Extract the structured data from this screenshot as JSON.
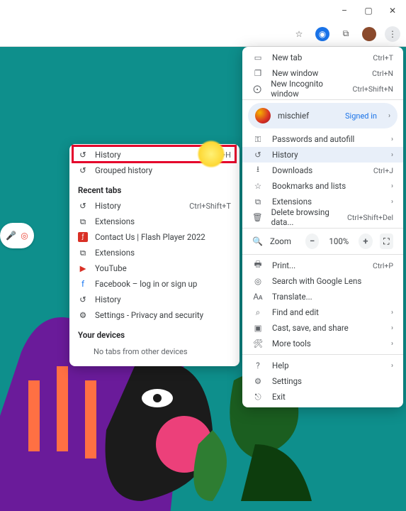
{
  "window_controls": {
    "min": "–",
    "max": "▢",
    "close": "✕"
  },
  "toolbar": {
    "star": "☆",
    "ext": "⧉",
    "more": "⋮"
  },
  "menu": {
    "new_tab": {
      "label": "New tab",
      "shortcut": "Ctrl+T"
    },
    "new_window": {
      "label": "New window",
      "shortcut": "Ctrl+N"
    },
    "incognito": {
      "label": "New Incognito window",
      "shortcut": "Ctrl+Shift+N"
    },
    "profile": {
      "name": "mischief",
      "state": "Signed in"
    },
    "passwords": {
      "label": "Passwords and autofill"
    },
    "history": {
      "label": "History"
    },
    "downloads": {
      "label": "Downloads",
      "shortcut": "Ctrl+J"
    },
    "bookmarks": {
      "label": "Bookmarks and lists"
    },
    "extensions": {
      "label": "Extensions"
    },
    "clear": {
      "label": "Delete browsing data...",
      "shortcut": "Ctrl+Shift+Del"
    },
    "zoom": {
      "label": "Zoom",
      "value": "100%"
    },
    "print": {
      "label": "Print...",
      "shortcut": "Ctrl+P"
    },
    "lens": {
      "label": "Search with Google Lens"
    },
    "translate": {
      "label": "Translate..."
    },
    "find": {
      "label": "Find and edit"
    },
    "cast": {
      "label": "Cast, save, and share"
    },
    "more_tools": {
      "label": "More tools"
    },
    "help": {
      "label": "Help"
    },
    "settings": {
      "label": "Settings"
    },
    "exit": {
      "label": "Exit"
    }
  },
  "submenu": {
    "history": {
      "label": "History",
      "shortcut": "Ctrl+H"
    },
    "grouped": {
      "label": "Grouped history"
    },
    "recent_title": "Recent tabs",
    "recents": [
      {
        "icon": "history",
        "label": "History",
        "shortcut": "Ctrl+Shift+T"
      },
      {
        "icon": "ext",
        "label": "Extensions",
        "shortcut": ""
      },
      {
        "icon": "flash",
        "label": "Contact Us | Flash Player 2022",
        "shortcut": ""
      },
      {
        "icon": "ext",
        "label": "Extensions",
        "shortcut": ""
      },
      {
        "icon": "yt",
        "label": "YouTube",
        "shortcut": ""
      },
      {
        "icon": "fb",
        "label": "Facebook – log in or sign up",
        "shortcut": ""
      },
      {
        "icon": "history",
        "label": "History",
        "shortcut": ""
      },
      {
        "icon": "gear",
        "label": "Settings - Privacy and security",
        "shortcut": ""
      }
    ],
    "devices_title": "Your devices",
    "no_tabs": "No tabs from other devices"
  }
}
